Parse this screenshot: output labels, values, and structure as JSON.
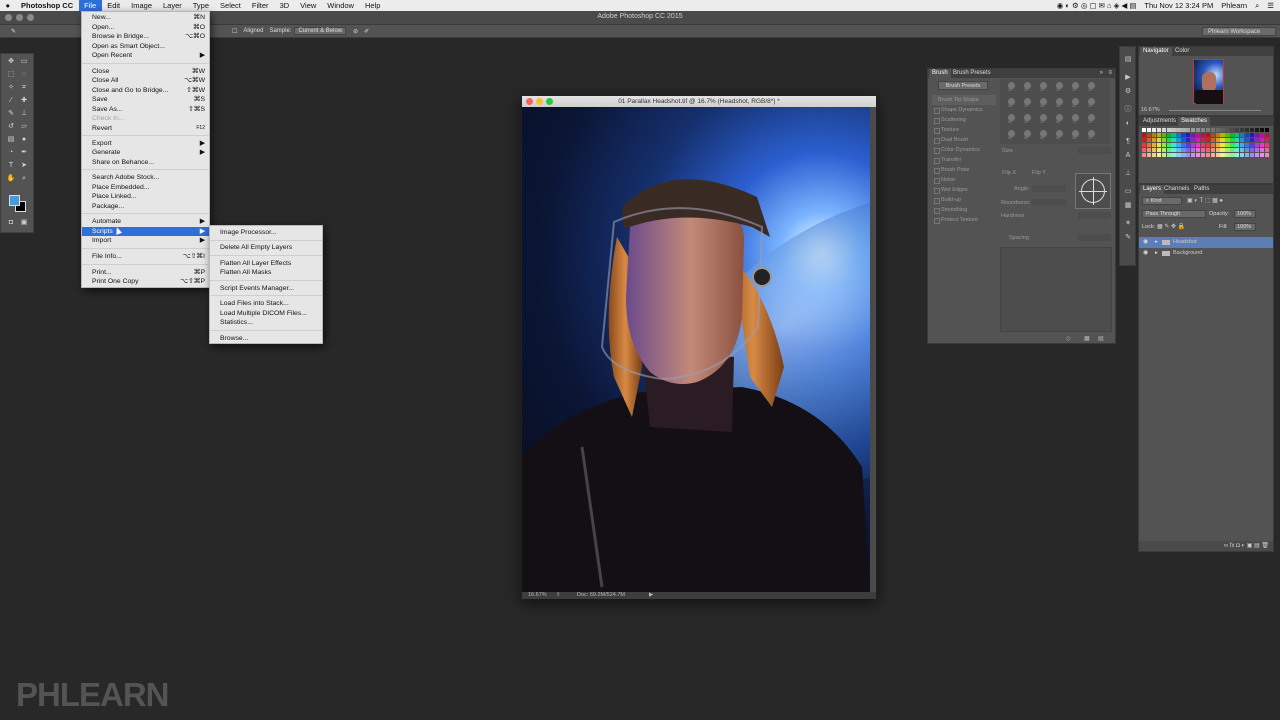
{
  "menubar": {
    "app": "Photoshop CC",
    "items": [
      "File",
      "Edit",
      "Image",
      "Layer",
      "Type",
      "Select",
      "Filter",
      "3D",
      "View",
      "Window",
      "Help"
    ],
    "clock": "Thu Nov 12  3:24 PM",
    "user": "Phlearn"
  },
  "app_title": "Adobe Photoshop CC 2015",
  "options_bar": {
    "aligned_label": "Aligned",
    "sample_label": "Sample:",
    "sample_value": "Current & Below",
    "workspace": "Phlearn Workspace"
  },
  "file_menu": {
    "items": [
      {
        "label": "New...",
        "shortcut": "⌘N"
      },
      {
        "label": "Open...",
        "shortcut": "⌘O"
      },
      {
        "label": "Browse in Bridge...",
        "shortcut": "⌥⌘O"
      },
      {
        "label": "Open as Smart Object...",
        "shortcut": ""
      },
      {
        "label": "Open Recent",
        "shortcut": "▶"
      },
      {
        "label": "Close",
        "shortcut": "⌘W"
      },
      {
        "label": "Close All",
        "shortcut": "⌥⌘W"
      },
      {
        "label": "Close and Go to Bridge...",
        "shortcut": "⇧⌘W"
      },
      {
        "label": "Save",
        "shortcut": "⌘S"
      },
      {
        "label": "Save As...",
        "shortcut": "⇧⌘S"
      },
      {
        "label": "Check In...",
        "shortcut": ""
      },
      {
        "label": "Revert",
        "shortcut": "F12"
      },
      {
        "label": "Export",
        "shortcut": "▶"
      },
      {
        "label": "Generate",
        "shortcut": "▶"
      },
      {
        "label": "Share on Behance...",
        "shortcut": ""
      },
      {
        "label": "Search Adobe Stock...",
        "shortcut": ""
      },
      {
        "label": "Place Embedded...",
        "shortcut": ""
      },
      {
        "label": "Place Linked...",
        "shortcut": ""
      },
      {
        "label": "Package...",
        "shortcut": ""
      },
      {
        "label": "Automate",
        "shortcut": "▶"
      },
      {
        "label": "Scripts",
        "shortcut": "▶"
      },
      {
        "label": "Import",
        "shortcut": "▶"
      },
      {
        "label": "File Info...",
        "shortcut": "⌥⇧⌘I"
      },
      {
        "label": "Print...",
        "shortcut": "⌘P"
      },
      {
        "label": "Print One Copy",
        "shortcut": "⌥⇧⌘P"
      }
    ]
  },
  "scripts_submenu": {
    "items": [
      "Image Processor...",
      "Delete All Empty Layers",
      "Flatten All Layer Effects",
      "Flatten All Masks",
      "Script Events Manager...",
      "Load Files into Stack...",
      "Load Multiple DICOM Files...",
      "Statistics...",
      "Browse..."
    ]
  },
  "document": {
    "title": "01 Parallax Headshot.tif @ 16.7% (Headshot, RGB/8*) *",
    "zoom": "16.67%",
    "doc_size": "Doc: 69.2M/524.7M"
  },
  "brush_panel": {
    "tabs": [
      "Brush",
      "Brush Presets"
    ],
    "presets_button": "Brush Presets",
    "options": [
      "Brush Tip Shape",
      "Shape Dynamics",
      "Scattering",
      "Texture",
      "Dual Brush",
      "Color Dynamics",
      "Transfer",
      "Brush Pose",
      "Noise",
      "Wet Edges",
      "Build-up",
      "Smoothing",
      "Protect Texture"
    ],
    "tip_sizes": [
      "30",
      "30",
      "30",
      "25",
      "25",
      "25",
      "36",
      "25",
      "36",
      "36",
      "32",
      "25",
      "50",
      "25",
      "25",
      "50",
      "71",
      "25",
      "50",
      "50",
      "50",
      "50",
      "36",
      "30"
    ],
    "size_label": "Size",
    "flip_x": "Flip X",
    "flip_y": "Flip Y",
    "angle_label": "Angle:",
    "roundness_label": "Roundness:",
    "hardness_label": "Hardness",
    "spacing_label": "Spacing"
  },
  "navigator_panel": {
    "tabs": [
      "Navigator",
      "Color"
    ],
    "zoom": "16.67%"
  },
  "swatch_panel": {
    "tabs": [
      "Adjustments",
      "Swatches"
    ]
  },
  "layers_panel": {
    "tabs": [
      "Layers",
      "Channels",
      "Paths"
    ],
    "filter": "Kind",
    "blend_mode": "Pass Through",
    "opacity_label": "Opacity:",
    "opacity": "100%",
    "lock_label": "Lock:",
    "fill_label": "Fill:",
    "fill": "100%",
    "layers": [
      "Headshot",
      "Background"
    ]
  },
  "watermark": "PHLEARN"
}
